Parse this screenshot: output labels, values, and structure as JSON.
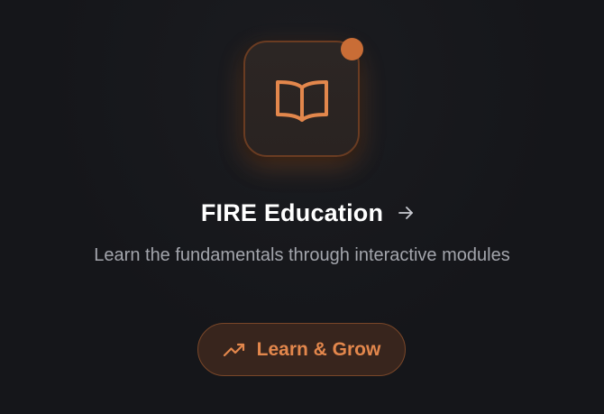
{
  "card": {
    "title": "FIRE Education",
    "subtitle": "Learn the fundamentals through interactive modules",
    "icon": "book-open-icon",
    "title_arrow_icon": "arrow-right-icon",
    "has_notification_dot": true,
    "cta": {
      "label": "Learn & Grow",
      "icon": "trending-up-icon"
    }
  },
  "colors": {
    "background": "#15161a",
    "accent": "#e3874c",
    "tile_background": "#2a2321",
    "notification_dot": "#c96d36",
    "subtitle_text": "#a3a5ac",
    "button_background": "#38251d"
  }
}
